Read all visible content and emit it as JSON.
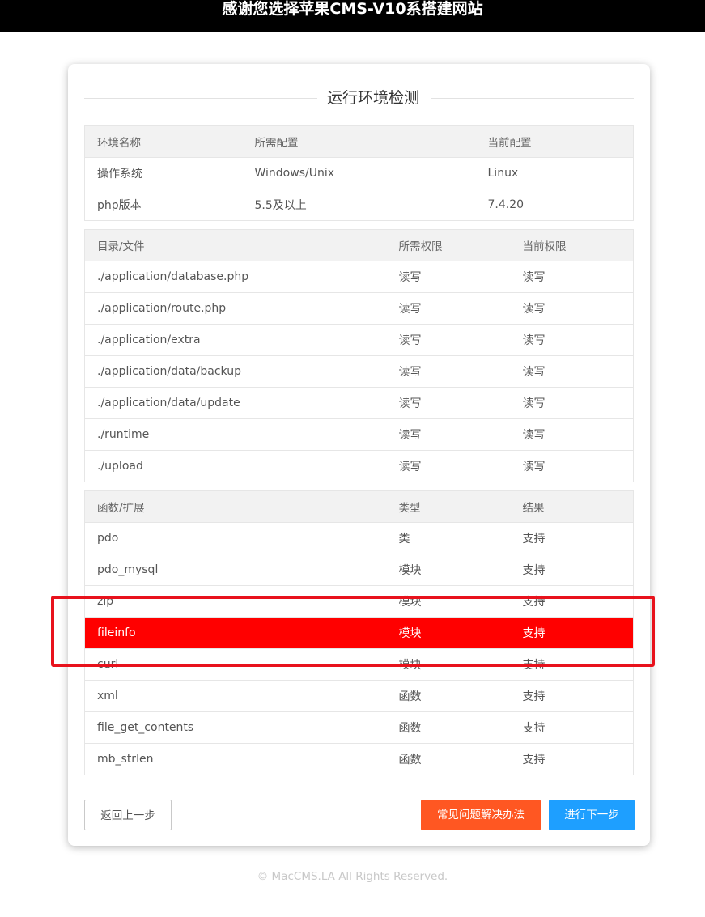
{
  "header": {
    "title": "感谢您选择苹果CMS-V10系搭建网站"
  },
  "section_title": "运行环境检测",
  "env_table": {
    "headers": [
      "环境名称",
      "所需配置",
      "当前配置"
    ],
    "rows": [
      [
        "操作系统",
        "Windows/Unix",
        "Linux"
      ],
      [
        "php版本",
        "5.5及以上",
        "7.4.20"
      ]
    ]
  },
  "perm_table": {
    "headers": [
      "目录/文件",
      "所需权限",
      "当前权限"
    ],
    "rows": [
      [
        "./application/database.php",
        "读写",
        "读写"
      ],
      [
        "./application/route.php",
        "读写",
        "读写"
      ],
      [
        "./application/extra",
        "读写",
        "读写"
      ],
      [
        "./application/data/backup",
        "读写",
        "读写"
      ],
      [
        "./application/data/update",
        "读写",
        "读写"
      ],
      [
        "./runtime",
        "读写",
        "读写"
      ],
      [
        "./upload",
        "读写",
        "读写"
      ]
    ]
  },
  "func_table": {
    "headers": [
      "函数/扩展",
      "类型",
      "结果"
    ],
    "rows": [
      [
        "pdo",
        "类",
        "支持"
      ],
      [
        "pdo_mysql",
        "模块",
        "支持"
      ],
      [
        "zip",
        "模块",
        "支持"
      ],
      [
        "fileinfo",
        "模块",
        "支持"
      ],
      [
        "curl",
        "模块",
        "支持"
      ],
      [
        "xml",
        "函数",
        "支持"
      ],
      [
        "file_get_contents",
        "函数",
        "支持"
      ],
      [
        "mb_strlen",
        "函数",
        "支持"
      ]
    ],
    "highlight_row": "fileinfo",
    "highlight_color": "#ff0000"
  },
  "buttons": {
    "back": "返回上一步",
    "faq": "常见问题解决办法",
    "next": "进行下一步"
  },
  "colors": {
    "faq_button": "#ff5722",
    "next_button": "#1e9fff",
    "annotation_box": "#e8121c"
  },
  "footer": "© MacCMS.LA All Rights Reserved."
}
